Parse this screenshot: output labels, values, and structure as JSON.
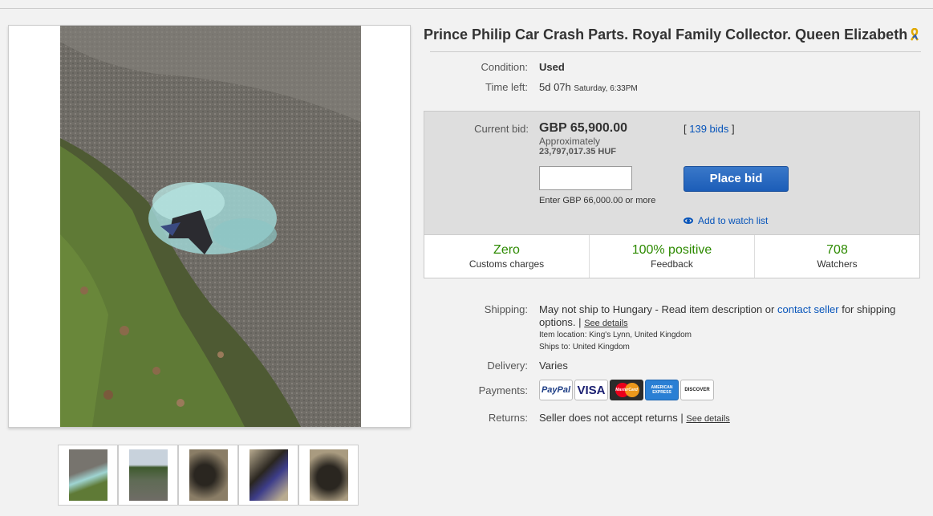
{
  "listing": {
    "title": "Prince Philip Car Crash Parts. Royal Family Collector. Queen Elizabeth",
    "condition_label": "Condition:",
    "condition_value": "Used",
    "time_left_label": "Time left:",
    "time_left_value": "5d 07h",
    "time_left_end": "Saturday, 6:33PM"
  },
  "bid": {
    "current_bid_label": "Current bid:",
    "current_bid_value": "GBP 65,900.00",
    "approx_label": "Approximately",
    "approx_value": "23,797,017.35 HUF",
    "bids_prefix": "[",
    "bids_link": "139 bids",
    "bids_suffix": "]",
    "input_value": "",
    "enter_hint": "Enter GBP 66,000.00 or more",
    "place_bid_label": "Place bid",
    "watch_label": "Add to watch list"
  },
  "stats": [
    {
      "big": "Zero",
      "small": "Customs charges"
    },
    {
      "big": "100% positive",
      "small": "Feedback"
    },
    {
      "big": "708",
      "small": "Watchers"
    }
  ],
  "shipping": {
    "label": "Shipping:",
    "text_before": "May not ship to Hungary - Read item description or",
    "contact_link": "contact seller",
    "text_after": "for shipping",
    "line2": "options.",
    "separator": "|",
    "see_details": "See details",
    "location_label": "Item location:",
    "location_value": "King's Lynn, United Kingdom",
    "ships_to_label": "Ships to:",
    "ships_to_value": "United Kingdom"
  },
  "delivery": {
    "label": "Delivery:",
    "value": "Varies"
  },
  "payments": {
    "label": "Payments:",
    "methods": [
      "PayPal",
      "VISA",
      "MasterCard",
      "AMERICAN EXPRESS",
      "DISCOVER"
    ]
  },
  "returns": {
    "label": "Returns:",
    "value": "Seller does not accept returns",
    "separator": "|",
    "see_details": "See details"
  },
  "icons": {
    "ribbon": "awareness-ribbon-icon",
    "eye": "eye-icon"
  },
  "colors": {
    "link": "#0654ba",
    "stat_green": "#2d8a00",
    "button_blue": "#1c5db8",
    "glass_teal": "#9fd4d2"
  }
}
